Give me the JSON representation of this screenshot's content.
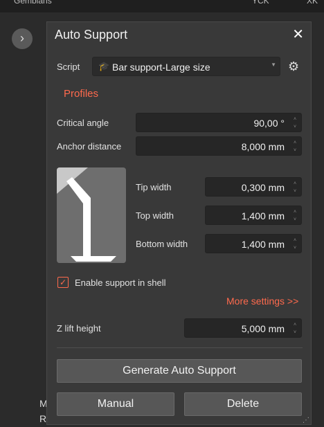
{
  "background": {
    "top_left_text": "Gemblans",
    "top_right_text_1": "YCK",
    "top_right_text_2": "XK",
    "collapse_icon": "chevron-right-icon",
    "side_letter_1": "M",
    "side_letter_2": "R"
  },
  "panel": {
    "title": "Auto Support",
    "close_icon": "close-icon"
  },
  "script": {
    "label": "Script",
    "icon": "graduation-cap-icon",
    "value": "Bar support-Large size",
    "settings_icon": "gear-icon"
  },
  "profiles_label": "Profiles",
  "fields": {
    "critical_angle": {
      "label": "Critical angle",
      "value": "90,00 °"
    },
    "anchor_distance": {
      "label": "Anchor distance",
      "value": "8,000 mm"
    },
    "tip_width": {
      "label": "Tip width",
      "value": "0,300 mm"
    },
    "top_width": {
      "label": "Top width",
      "value": "1,400 mm"
    },
    "bottom_width": {
      "label": "Bottom width",
      "value": "1,400 mm"
    },
    "z_lift_height": {
      "label": "Z lift height",
      "value": "5,000 mm"
    }
  },
  "enable_shell": {
    "label": "Enable support in shell",
    "checked": true
  },
  "more_settings": "More settings >>",
  "buttons": {
    "generate": "Generate Auto Support",
    "manual": "Manual",
    "delete": "Delete"
  },
  "colors": {
    "accent": "#ff6a4d",
    "panel_bg": "#393939",
    "field_bg": "#262626",
    "button_bg": "#575757"
  }
}
